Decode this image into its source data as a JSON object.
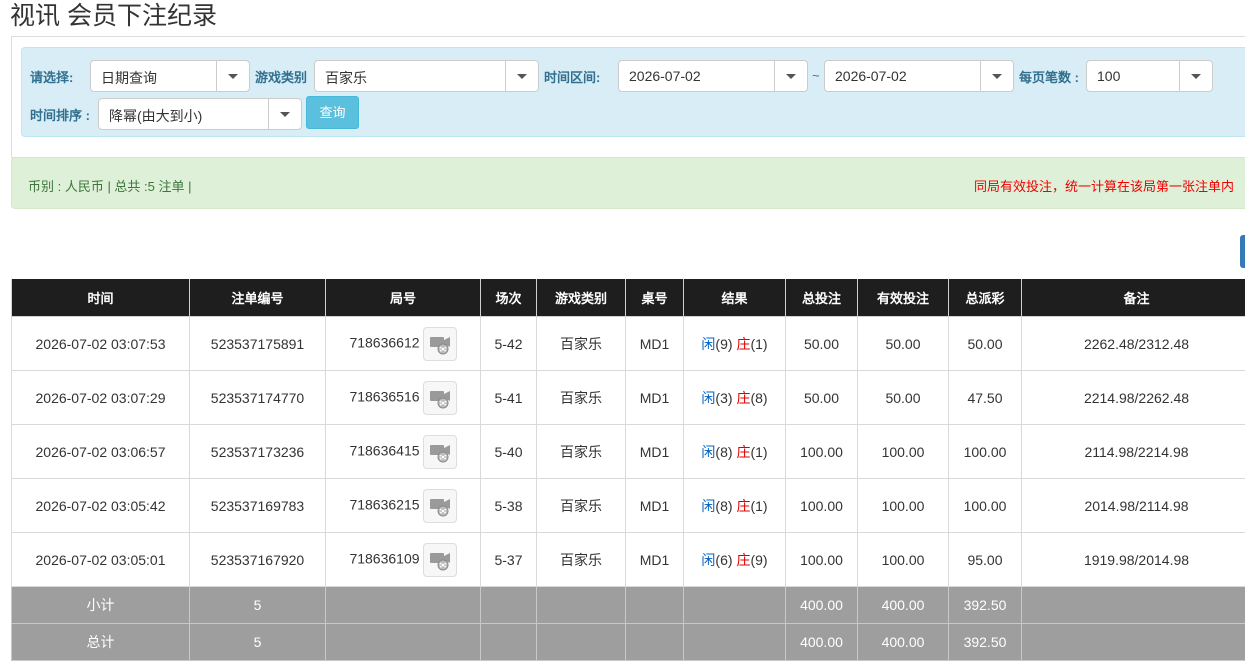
{
  "page": {
    "title": "视讯 会员下注纪录"
  },
  "filters": {
    "select_label": "请选择:",
    "select_value": "日期查询",
    "game_type_label": "游戏类别",
    "game_type_value": "百家乐",
    "time_range_label": "时间区间:",
    "date_from": "2026-07-02",
    "tilde": "~",
    "date_to": "2026-07-02",
    "page_size_label": "每页笔数 :",
    "page_size_value": "100",
    "sort_label": "时间排序 :",
    "sort_value": "降幂(由大到小)",
    "query_button": "查询"
  },
  "summary": {
    "left": "币别 : 人民币 | 总共 :5 注单 |",
    "right": "同局有效投注，统一计算在该局第一张注单内"
  },
  "table": {
    "headers": [
      "时间",
      "注单编号",
      "局号",
      "场次",
      "游戏类别",
      "桌号",
      "结果",
      "总投注",
      "有效投注",
      "总派彩",
      "备注"
    ],
    "rows": [
      {
        "time": "2026-07-02 03:07:53",
        "bet_no": "523537175891",
        "round": "718636612",
        "session": "5-42",
        "game": "百家乐",
        "table": "MD1",
        "result_player_label": "闲",
        "result_player": "(9)",
        "result_banker_label": "庄",
        "result_banker": "(1)",
        "total_bet": "50.00",
        "valid_bet": "50.00",
        "payout": "50.00",
        "note": "2262.48/2312.48"
      },
      {
        "time": "2026-07-02 03:07:29",
        "bet_no": "523537174770",
        "round": "718636516",
        "session": "5-41",
        "game": "百家乐",
        "table": "MD1",
        "result_player_label": "闲",
        "result_player": "(3)",
        "result_banker_label": "庄",
        "result_banker": "(8)",
        "total_bet": "50.00",
        "valid_bet": "50.00",
        "payout": "47.50",
        "note": "2214.98/2262.48"
      },
      {
        "time": "2026-07-02 03:06:57",
        "bet_no": "523537173236",
        "round": "718636415",
        "session": "5-40",
        "game": "百家乐",
        "table": "MD1",
        "result_player_label": "闲",
        "result_player": "(8)",
        "result_banker_label": "庄",
        "result_banker": "(1)",
        "total_bet": "100.00",
        "valid_bet": "100.00",
        "payout": "100.00",
        "note": "2114.98/2214.98"
      },
      {
        "time": "2026-07-02 03:05:42",
        "bet_no": "523537169783",
        "round": "718636215",
        "session": "5-38",
        "game": "百家乐",
        "table": "MD1",
        "result_player_label": "闲",
        "result_player": "(8)",
        "result_banker_label": "庄",
        "result_banker": "(1)",
        "total_bet": "100.00",
        "valid_bet": "100.00",
        "payout": "100.00",
        "note": "2014.98/2114.98"
      },
      {
        "time": "2026-07-02 03:05:01",
        "bet_no": "523537167920",
        "round": "718636109",
        "session": "5-37",
        "game": "百家乐",
        "table": "MD1",
        "result_player_label": "闲",
        "result_player": "(6)",
        "result_banker_label": "庄",
        "result_banker": "(9)",
        "total_bet": "100.00",
        "valid_bet": "100.00",
        "payout": "95.00",
        "note": "1919.98/2014.98"
      }
    ],
    "subtotal": {
      "label": "小计",
      "count": "5",
      "total_bet": "400.00",
      "valid_bet": "400.00",
      "payout": "392.50"
    },
    "grandtotal": {
      "label": "总计",
      "count": "5",
      "total_bet": "400.00",
      "valid_bet": "400.00",
      "payout": "392.50"
    }
  },
  "icons": {
    "replay": "video-replay-icon",
    "caret": "chevron-down-icon"
  },
  "colors": {
    "header_bg": "#1e1e1e",
    "filter_bg": "#d9edf7",
    "summary_bg": "#dff0d8",
    "total_bg": "#9e9e9e",
    "player_blue": "#0060c0",
    "banker_red": "#d00000",
    "query_button": "#5bc0de"
  }
}
